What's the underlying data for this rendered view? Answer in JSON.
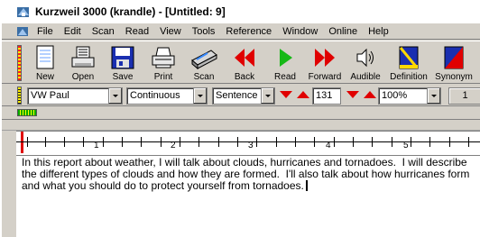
{
  "window": {
    "title": "Kurzweil 3000 (krandle) - [Untitled: 9]"
  },
  "menu": [
    "File",
    "Edit",
    "Scan",
    "Read",
    "View",
    "Tools",
    "Reference",
    "Window",
    "Online",
    "Help"
  ],
  "toolbar": {
    "new": "New",
    "open": "Open",
    "save": "Save",
    "print": "Print",
    "scan": "Scan",
    "back": "Back",
    "read": "Read",
    "forward": "Forward",
    "audible": "Audible",
    "definition": "Definition",
    "synonym": "Synonym"
  },
  "format": {
    "voice": "VW Paul",
    "mode": "Continuous",
    "unit": "Sentence",
    "speed": "131",
    "zoom": "100%",
    "extra": "1"
  },
  "ruler": {
    "numbers": [
      "1",
      "2",
      "3",
      "4",
      "5"
    ]
  },
  "document": {
    "text": "In this report about weather, I will talk about clouds, hurricanes and tornadoes.  I will describe the different types of clouds and how they are formed.  I'll also talk about how hurricanes form and what you should do to protect yourself from tornadoes."
  },
  "colors": {
    "accent_red": "#e00000",
    "read_green": "#16b816",
    "face": "#d4d0c8"
  }
}
